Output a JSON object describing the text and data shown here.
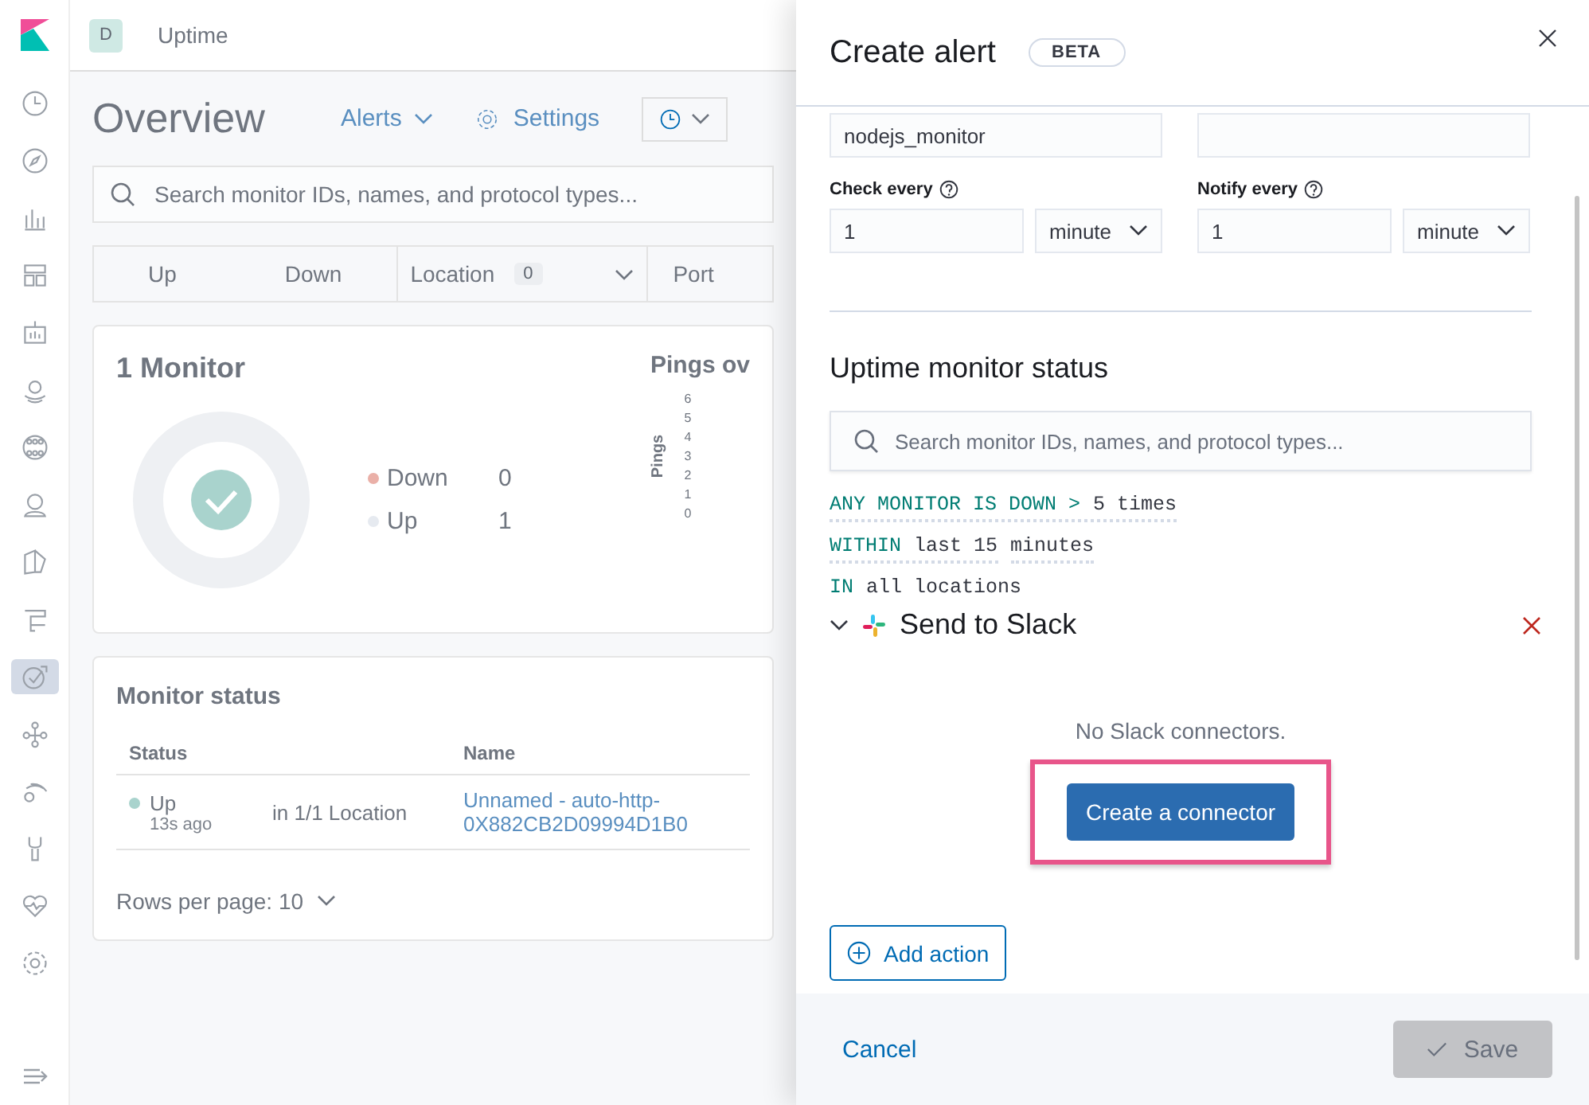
{
  "sidebar": {
    "items": [
      {
        "selected": false
      },
      {
        "selected": false
      },
      {
        "selected": false
      },
      {
        "selected": false
      },
      {
        "selected": false
      },
      {
        "selected": false
      },
      {
        "selected": false
      },
      {
        "selected": false
      },
      {
        "selected": false
      },
      {
        "selected": false
      },
      {
        "selected": true
      },
      {
        "selected": false
      },
      {
        "selected": false
      },
      {
        "selected": false
      },
      {
        "selected": false
      },
      {
        "selected": false
      }
    ]
  },
  "header": {
    "avatar": "D",
    "breadcrumb": "Uptime"
  },
  "overview": {
    "title": "Overview",
    "alerts": "Alerts",
    "settings": "Settings",
    "search": {
      "placeholder": "Search monitor IDs, names, and protocol types..."
    },
    "filters": {
      "up": "Up",
      "down": "Down",
      "location": "Location",
      "location_count": "0",
      "port": "Port"
    },
    "snapshot": {
      "title": "1 Monitor",
      "legend": [
        {
          "label": "Down",
          "value": "0",
          "color": "#eab0a8"
        },
        {
          "label": "Up",
          "value": "1",
          "color": "#e6eaf0"
        }
      ],
      "pings": {
        "title": "Pings ov",
        "ylabel": "Pings",
        "ticks": [
          "6",
          "5",
          "4",
          "3",
          "2",
          "1",
          "0"
        ]
      }
    },
    "monitor_status": {
      "title": "Monitor status",
      "columns": [
        "Status",
        "Name"
      ],
      "rows": [
        {
          "status": "Up",
          "ago": "13s ago",
          "location": "in 1/1 Location",
          "name": "Unnamed - auto-http-0X882CB2D09994D1B0"
        }
      ],
      "rows_per_page": "Rows per page: 10"
    }
  },
  "flyout": {
    "title": "Create alert",
    "badge": "BETA",
    "index_field": {
      "value": "nodejs_monitor"
    },
    "check": {
      "label": "Check every",
      "value": "1",
      "unit": "minute"
    },
    "notify": {
      "label": "Notify every",
      "value": "1",
      "unit": "minute"
    },
    "section_title": "Uptime monitor status",
    "search": {
      "placeholder": "Search monitor IDs, names, and protocol types..."
    },
    "expressions": [
      {
        "keyword": "ANY MONITOR IS DOWN >",
        "values": [
          "5 times"
        ],
        "underlined": true
      },
      {
        "keyword": "WITHIN",
        "values": [
          "last 15",
          "minutes"
        ],
        "underlined": true
      },
      {
        "keyword": "IN",
        "values": [
          "all locations"
        ],
        "underlined": false
      }
    ],
    "action": {
      "title": "Send to Slack",
      "expanded": true,
      "empty_text": "No Slack connectors.",
      "create_button": "Create a connector",
      "highlighted": true
    },
    "add_action": "Add action",
    "cancel": "Cancel",
    "save": {
      "label": "Save",
      "disabled": true
    }
  }
}
